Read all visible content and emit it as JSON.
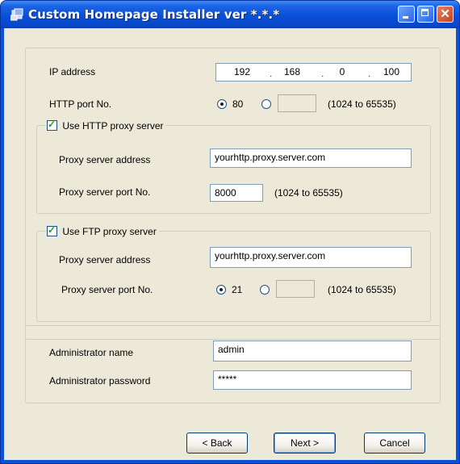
{
  "window": {
    "title": "Custom Homepage Installer ver *.*.*"
  },
  "network": {
    "ip_label": "IP address",
    "ip": [
      "192",
      "168",
      "0",
      "100"
    ],
    "http_port_label": "HTTP port No.",
    "http_port_option": "80",
    "http_port_custom": "",
    "http_port_range": "(1024 to 65535)"
  },
  "http_proxy": {
    "enable_label": "Use HTTP proxy server",
    "checked": true,
    "address_label": "Proxy server address",
    "address_value": "yourhttp.proxy.server.com",
    "port_label": "Proxy server port No.",
    "port_value": "8000",
    "port_range": "(1024 to 65535)"
  },
  "ftp_proxy": {
    "enable_label": "Use FTP proxy server",
    "checked": true,
    "address_label": "Proxy server address",
    "address_value": "yourhttp.proxy.server.com",
    "port_label": "Proxy server port No.",
    "port_option": "21",
    "port_custom": "",
    "port_range": "(1024 to 65535)"
  },
  "admin": {
    "name_label": "Administrator name",
    "name_value": "admin",
    "password_label": "Administrator password",
    "password_value": "*****"
  },
  "buttons": {
    "back": "< Back",
    "next": "Next >",
    "cancel": "Cancel"
  }
}
